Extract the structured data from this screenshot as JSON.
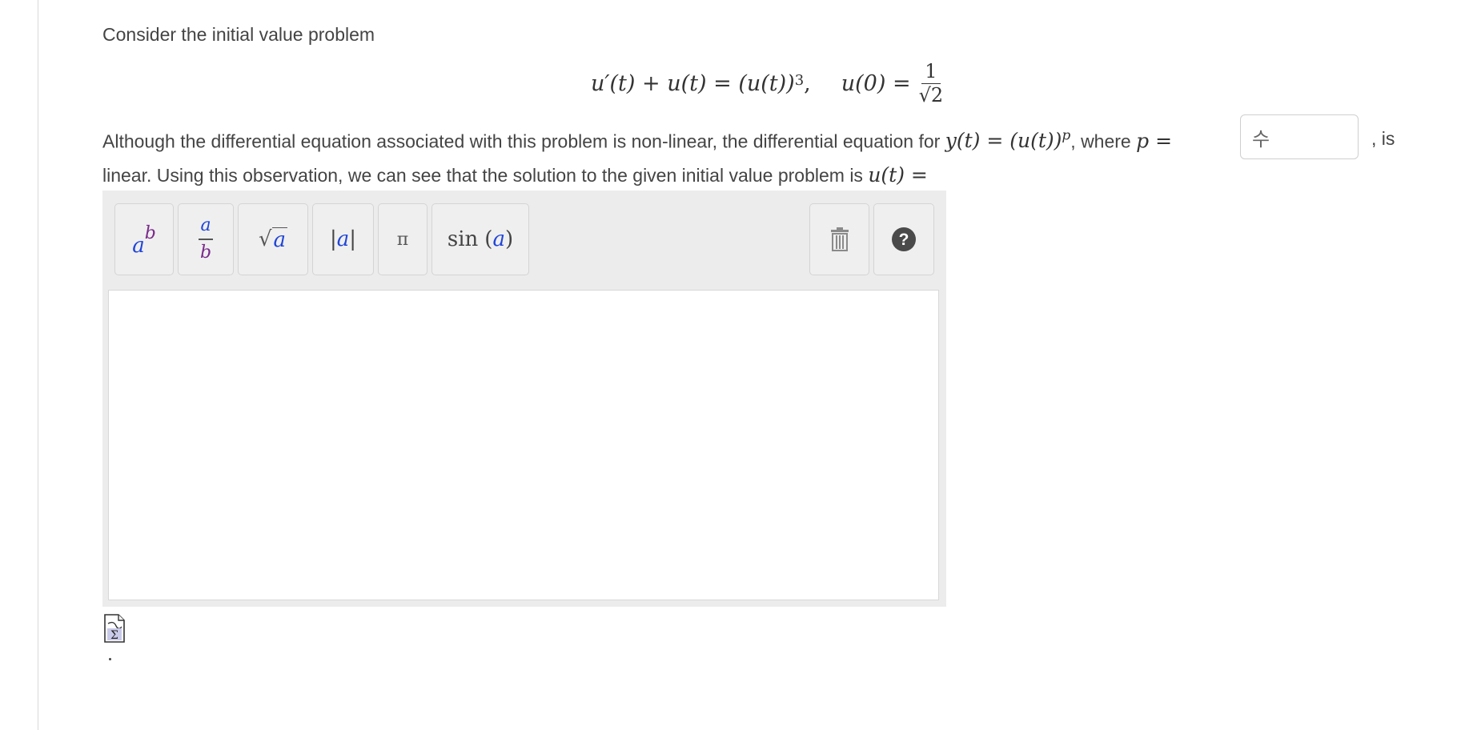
{
  "problem": {
    "intro": "Consider the initial value problem",
    "equation": {
      "lhs": "u′(t) + u(t) = (u(t))",
      "exponent": "3",
      "sep": ",",
      "ic": "u(0) =",
      "ic_num": "1",
      "ic_den": "√2"
    },
    "line1_text": "Although the differential equation associated with this problem is non-linear, the differential equation for",
    "substitution_math": "y(t) = (u(t))",
    "substitution_exp": "p",
    "where_text": ", where",
    "p_math": "p =",
    "p_input_value": "수",
    "is_text": ", is",
    "line2_text": "linear. Using this observation, we can see that the solution to the given initial value problem is",
    "solution_math": "u(t) ="
  },
  "editor": {
    "buttons": {
      "power_base": "a",
      "power_exp": "b",
      "frac_num": "a",
      "frac_den": "b",
      "sqrt_arg": "a",
      "abs_arg": "a",
      "pi": "π",
      "sin_fn": "sin",
      "sin_arg": "a"
    },
    "icons": [
      "trash-icon",
      "help-icon"
    ],
    "answer_value": ""
  },
  "footer": {
    "period": "."
  },
  "colors": {
    "accent_blue": "#2045d8",
    "accent_purple": "#7a2a8a",
    "help_dark": "#4a4a4a"
  }
}
